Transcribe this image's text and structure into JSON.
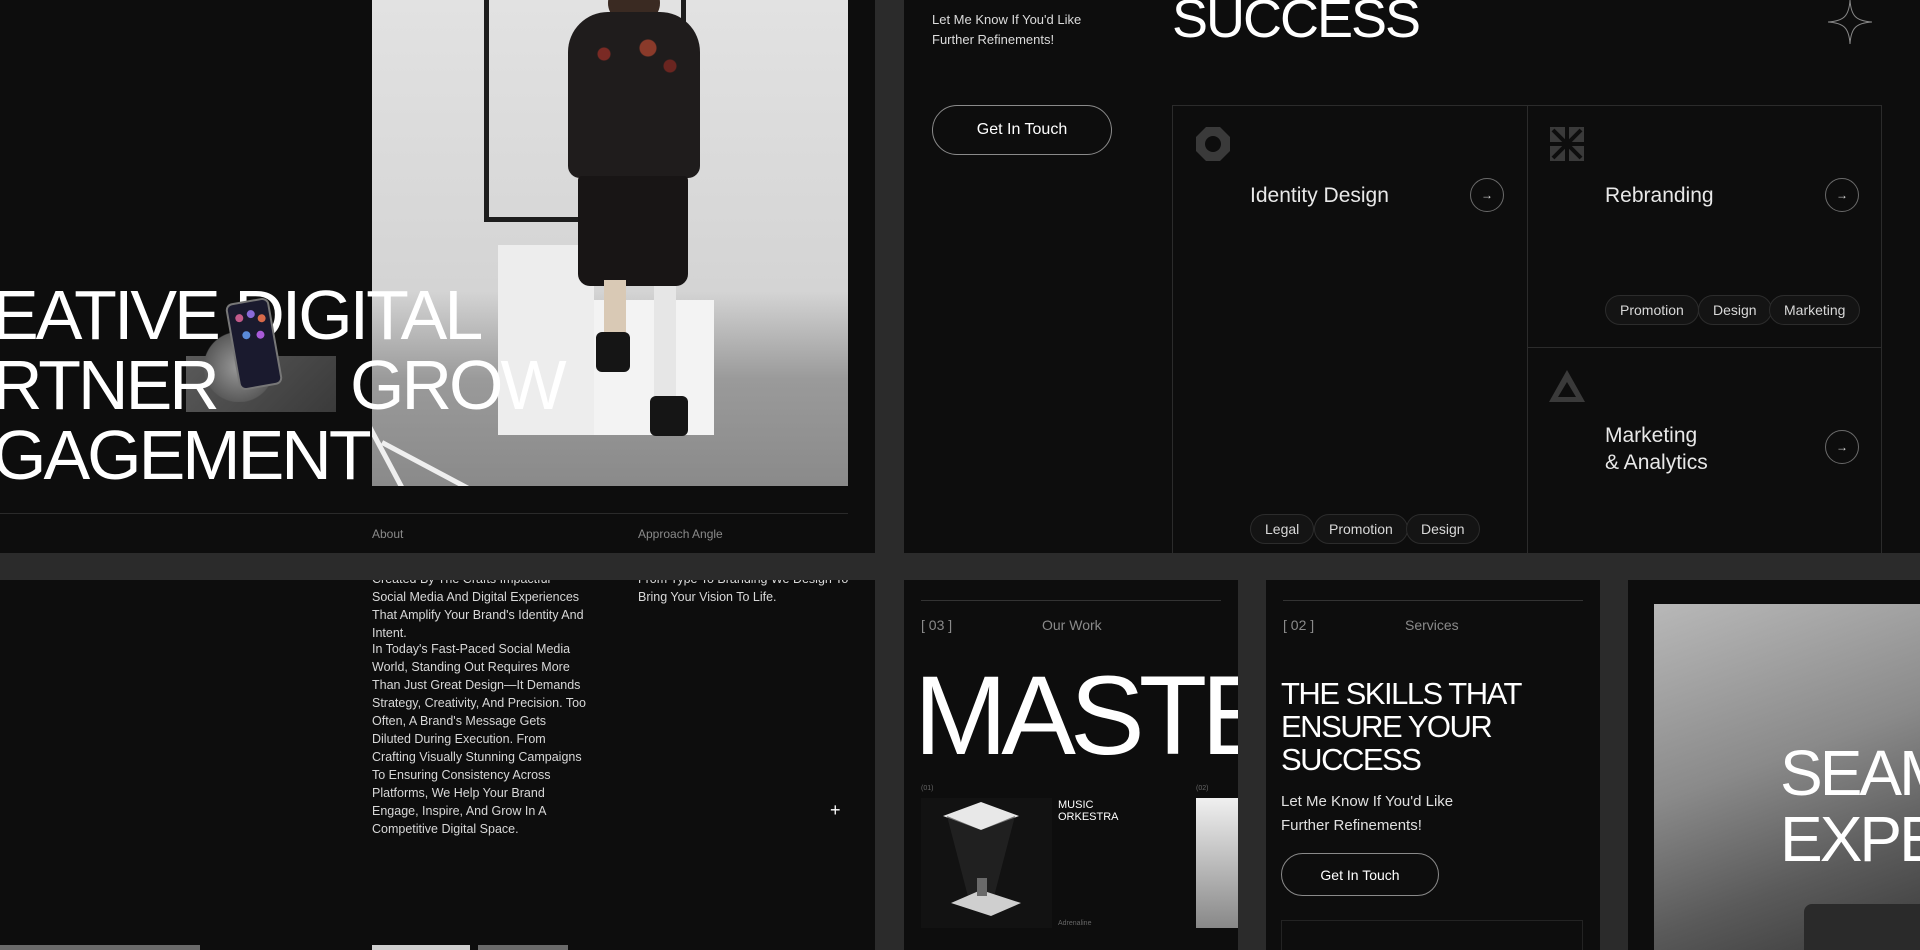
{
  "hero": {
    "lines": [
      "EATIVE DIGITAL",
      "RTNER",
      "GROW",
      "GAGEMENT"
    ],
    "labels": {
      "about": "About",
      "approach": "Approach Angle"
    }
  },
  "services_panel": {
    "subtitle": "Let Me Know If You'd Like Further Refinements!",
    "title": "SUCCESS",
    "cta": "Get In Touch",
    "cards": [
      {
        "title": "Identity Design",
        "tags": [
          "Legal",
          "Promotion",
          "Design"
        ]
      },
      {
        "title": "Rebranding",
        "tags": [
          "Promotion",
          "Design",
          "Marketing"
        ]
      },
      {
        "title_line1": "Marketing",
        "title_line2": "& Analytics"
      }
    ],
    "arrow": "→"
  },
  "about_panel": {
    "about_text_1": "Created By The Crafts Impactful Social Media And Digital Experiences That Amplify Your Brand's Identity And Intent.",
    "about_text_2": "In Today's Fast-Paced Social Media World, Standing Out Requires More Than Just Great Design—It Demands Strategy, Creativity, And Precision. Too Often, A Brand's Message Gets Diluted During Execution. From Crafting Visually Stunning Campaigns To Ensuring Consistency Across Platforms, We Help Your Brand Engage, Inspire, And Grow In A Competitive Digital Space.",
    "approach_text": "From Type To Branding We Design To Bring Your Vision To Life.",
    "plus": "+"
  },
  "work_panel": {
    "num": "[ 03 ]",
    "label": "Our Work",
    "big": "MASTE",
    "item1_num": "(01)",
    "item1_title": "MUSIC ORKESTRA",
    "item1_caption": "Adrenaline",
    "item2_num": "(02)"
  },
  "skills_panel": {
    "num": "[ 02 ]",
    "label": "Services",
    "title": "THE SKILLS THAT ENSURE YOUR SUCCESS",
    "subtitle": "Let Me Know If You'd Like Further Refinements!",
    "cta": "Get In Touch"
  },
  "seamless_panel": {
    "line1": "SEAM",
    "line2": "EXPE"
  }
}
